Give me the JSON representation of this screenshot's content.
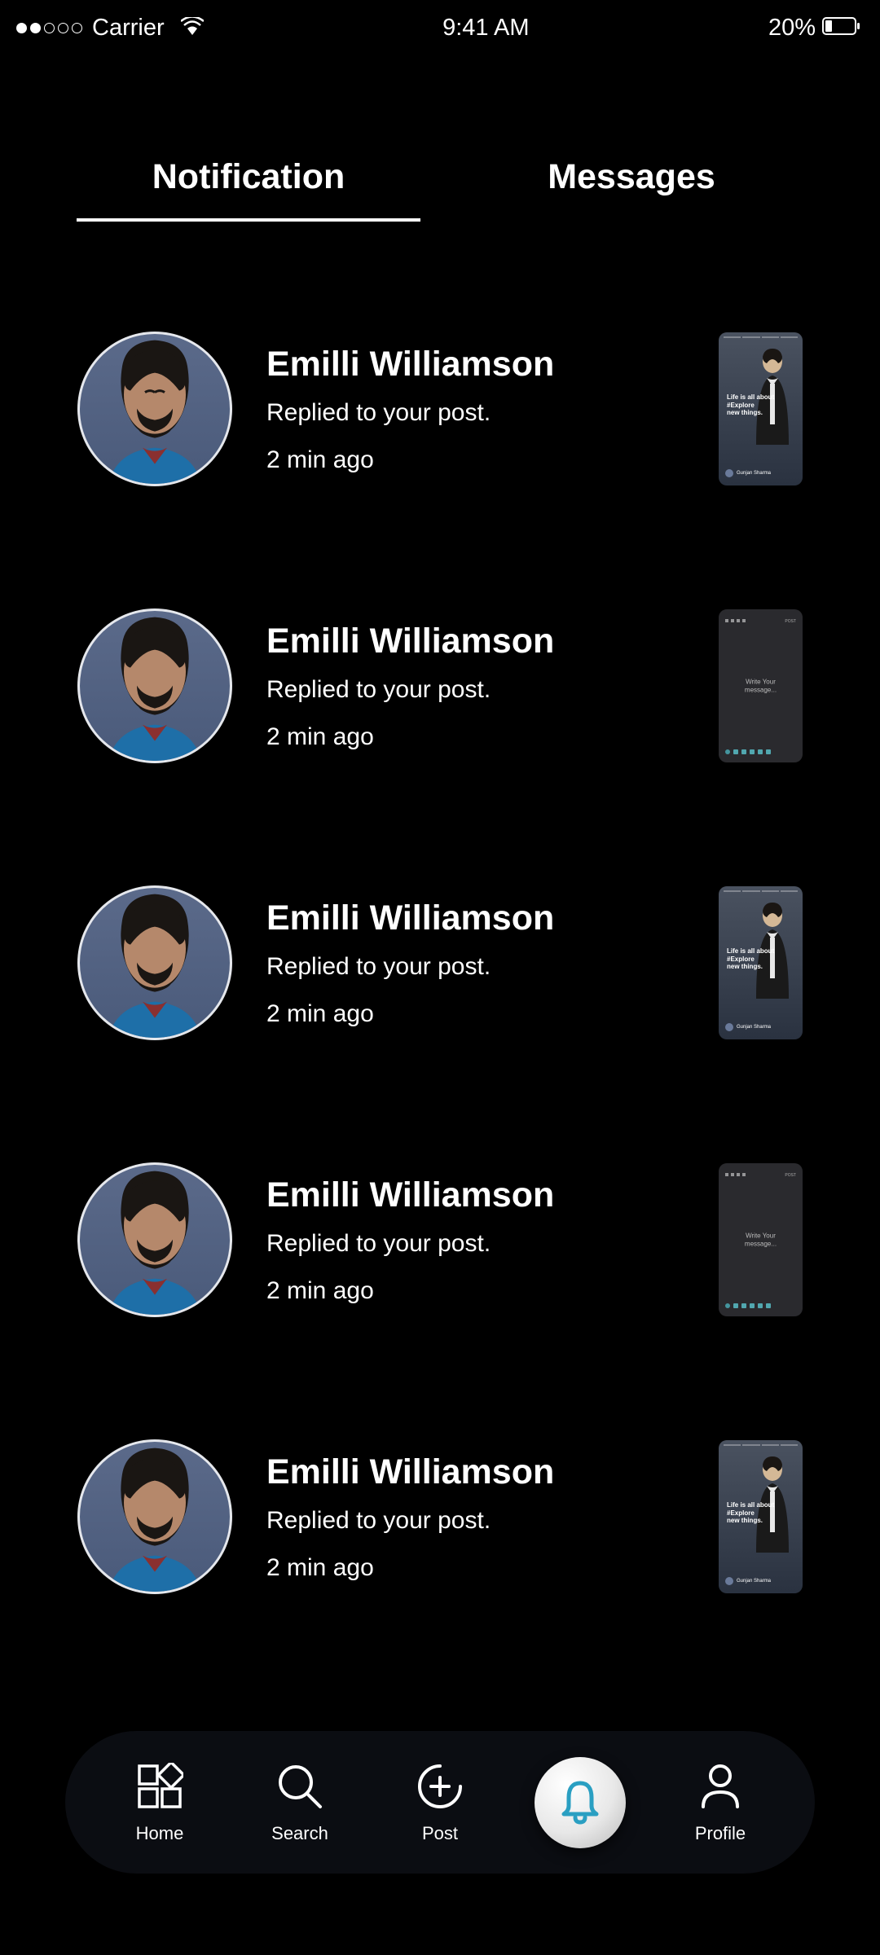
{
  "statusBar": {
    "carrier": "Carrier",
    "time": "9:41 AM",
    "battery": "20%"
  },
  "tabs": {
    "notification": "Notification",
    "messages": "Messages"
  },
  "notifications": [
    {
      "name": "Emilli Williamson",
      "action": "Replied to your post.",
      "time": "2 min ago",
      "thumbType": "story"
    },
    {
      "name": "Emilli Williamson",
      "action": "Replied to your post.",
      "time": "2 min ago",
      "thumbType": "message"
    },
    {
      "name": "Emilli Williamson",
      "action": "Replied to your post.",
      "time": "2 min ago",
      "thumbType": "story"
    },
    {
      "name": "Emilli Williamson",
      "action": "Replied to your post.",
      "time": "2 min ago",
      "thumbType": "message"
    },
    {
      "name": "Emilli Williamson",
      "action": "Replied to your post.",
      "time": "2 min ago",
      "thumbType": "story"
    }
  ],
  "thumbStory": {
    "text1": "Life is all about",
    "text2": "#Explore",
    "text3": "new things.",
    "author": "Gunjan Sharma"
  },
  "thumbMessage": {
    "center": "Write Your\nmessage...",
    "post": "POST"
  },
  "nav": {
    "home": "Home",
    "search": "Search",
    "post": "Post",
    "profile": "Profile"
  }
}
